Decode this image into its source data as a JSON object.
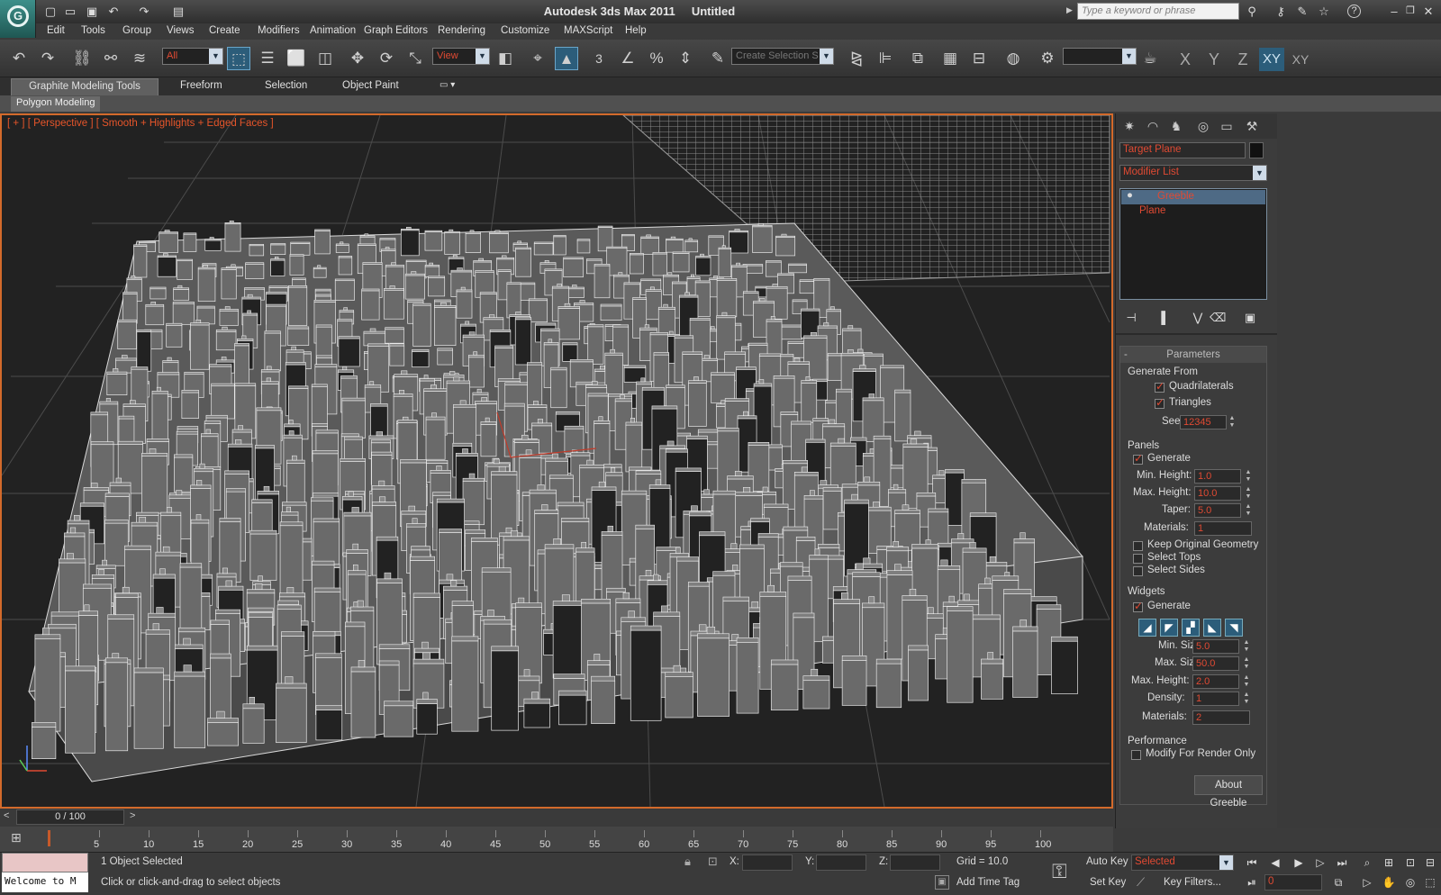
{
  "app": {
    "title": "Autodesk 3ds Max  2011",
    "document": "Untitled"
  },
  "search": {
    "placeholder": "Type a keyword or phrase"
  },
  "menu": [
    "Edit",
    "Tools",
    "Group",
    "Views",
    "Create",
    "Modifiers",
    "Animation",
    "Graph Editors",
    "Rendering",
    "Customize",
    "MAXScript",
    "Help"
  ],
  "toolbar": {
    "filter_value": "All",
    "coord_value": "View",
    "selection_set_placeholder": "Create Selection S",
    "axes": [
      "X",
      "Y",
      "Z",
      "XY",
      "XY"
    ],
    "snap_number": "3"
  },
  "ribbon": {
    "tabs": [
      "Graphite Modeling Tools",
      "Freeform",
      "Selection",
      "Object Paint"
    ],
    "panel_label": "Polygon Modeling"
  },
  "viewport": {
    "label": "[ + ] [ Perspective ] [ Smooth + Highlights + Edged Faces ]"
  },
  "command_panel": {
    "object_name": "Target Plane",
    "modifier_list": "Modifier List",
    "stack": [
      "Greeble",
      "Plane"
    ],
    "rollout_title": "Parameters",
    "generate_from": {
      "title": "Generate From",
      "quadrilaterals": "Quadrilaterals",
      "triangles": "Triangles",
      "seed_label": "Seed:",
      "seed": "12345"
    },
    "panels": {
      "title": "Panels",
      "generate": "Generate",
      "min_height_label": "Min. Height:",
      "min_height": "1.0",
      "max_height_label": "Max. Height:",
      "max_height": "10.0",
      "taper_label": "Taper:",
      "taper": "5.0",
      "materials_label": "Materials:",
      "materials": "1",
      "keep_original": "Keep Original Geometry",
      "select_tops": "Select Tops",
      "select_sides": "Select Sides"
    },
    "widgets": {
      "title": "Widgets",
      "generate": "Generate",
      "min_size_label": "Min. Size:",
      "min_size": "5.0",
      "max_size_label": "Max. Size:",
      "max_size": "50.0",
      "max_height_label": "Max. Height:",
      "max_height": "2.0",
      "density_label": "Density:",
      "density": "1",
      "materials_label": "Materials:",
      "materials": "2"
    },
    "performance": {
      "title": "Performance",
      "modify_render": "Modify For Render Only"
    },
    "about_button": "About Greeble"
  },
  "timeline": {
    "slider": "0 / 100",
    "prev": "<",
    "next": ">",
    "ticks": [
      "5",
      "10",
      "15",
      "20",
      "25",
      "30",
      "35",
      "40",
      "45",
      "50",
      "55",
      "60",
      "65",
      "70",
      "75",
      "80",
      "85",
      "90",
      "95",
      "100"
    ]
  },
  "status": {
    "welcome": "Welcome to M",
    "selected": "1 Object Selected",
    "prompt": "Click or click-and-drag to select objects",
    "x_label": "X:",
    "y_label": "Y:",
    "z_label": "Z:",
    "grid": "Grid = 10.0",
    "add_time_tag": "Add Time Tag",
    "auto_key": "Auto Key",
    "set_key": "Set Key",
    "selected_dropdown": "Selected",
    "key_filters": "Key Filters...",
    "frame": "0"
  },
  "colors": {
    "accent_orange": "#d36a2b",
    "value_red": "#e04a33",
    "active_blue": "#2c5d7a"
  }
}
